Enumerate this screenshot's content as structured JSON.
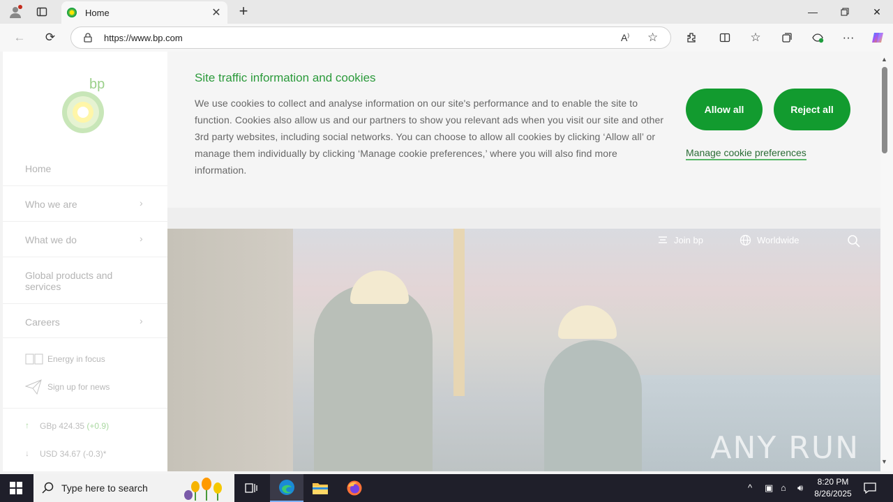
{
  "browser": {
    "tab_title": "Home",
    "url": "https://www.bp.com",
    "colors": {
      "accent": "#129b2f"
    }
  },
  "sidebar": {
    "logo_text": "bp",
    "items": [
      {
        "label": "Home",
        "has_children": false
      },
      {
        "label": "Who we are",
        "has_children": true
      },
      {
        "label": "What we do",
        "has_children": true
      },
      {
        "label": "Global products and services",
        "has_children": false
      },
      {
        "label": "Careers",
        "has_children": true
      }
    ],
    "chevron": "›",
    "links": [
      {
        "label": "Energy in focus",
        "icon": "book-icon"
      },
      {
        "label": "Sign up for news",
        "icon": "paper-plane-icon"
      }
    ],
    "stocks": [
      {
        "price": "GBp 424.35",
        "change": "(+0.9)",
        "direction": "up"
      },
      {
        "price": "USD 34.67",
        "change": "(-0.3)*",
        "direction": "down"
      }
    ]
  },
  "hero": {
    "join_label": "Join bp",
    "worldwide_label": "Worldwide",
    "watermark": "ANY RUN"
  },
  "cookie": {
    "title": "Site traffic information and cookies",
    "body": "We use cookies to collect and analyse information on our site's performance and to enable the site to function. Cookies also allow us and our partners to show you relevant ads when you visit our site and other 3rd party websites, including social networks. You can choose to allow all cookies by clicking ‘Allow all’ or manage them individually by clicking ‘Manage cookie preferences,’ where you will also find more information.",
    "allow_label": "Allow all",
    "reject_label": "Reject all",
    "manage_label": "Manage cookie preferences"
  },
  "taskbar": {
    "search_placeholder": "Type here to search",
    "time": "8:20 PM",
    "date": "8/26/2025"
  }
}
